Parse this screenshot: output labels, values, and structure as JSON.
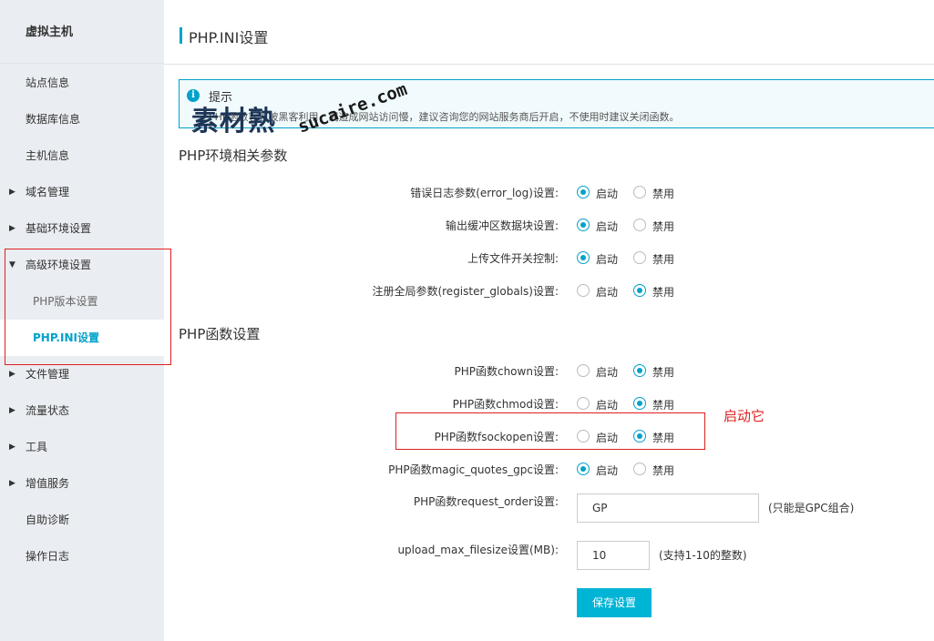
{
  "sidebar": {
    "title": "虚拟主机",
    "items": [
      {
        "label": "站点信息"
      },
      {
        "label": "数据库信息"
      },
      {
        "label": "主机信息"
      },
      {
        "label": "域名管理"
      },
      {
        "label": "基础环境设置"
      },
      {
        "label": "高级环境设置"
      },
      {
        "label": "PHP版本设置"
      },
      {
        "label": "PHP.INI设置"
      },
      {
        "label": "文件管理"
      },
      {
        "label": "流量状态"
      },
      {
        "label": "工具"
      },
      {
        "label": "增值服务"
      },
      {
        "label": "自助诊断"
      },
      {
        "label": "操作日志"
      }
    ]
  },
  "header": {
    "title": "PHP.INI设置"
  },
  "notice": {
    "title": "提示",
    "text": "PHP函数容易被黑客利用，或造成网站访问慢，建议咨询您的网站服务商后开启，不使用时建议关闭函数。"
  },
  "watermark": {
    "cn": "素材熟",
    "en": "sucaire.com"
  },
  "sections": {
    "env_title": "PHP环境相关参数",
    "func_title": "PHP函数设置"
  },
  "options": {
    "on": "启动",
    "off": "禁用"
  },
  "env_params": [
    {
      "label": "错误日志参数(error_log)设置:",
      "value": "启动"
    },
    {
      "label": "输出缓冲区数据块设置:",
      "value": "启动"
    },
    {
      "label": "上传文件开关控制:",
      "value": "启动"
    },
    {
      "label": "注册全局参数(register_globals)设置:",
      "value": "禁用"
    }
  ],
  "func_params": [
    {
      "label": "PHP函数chown设置:",
      "value": "禁用"
    },
    {
      "label": "PHP函数chmod设置:",
      "value": "禁用"
    },
    {
      "label": "PHP函数fsockopen设置:",
      "value": "禁用"
    },
    {
      "label": "PHP函数magic_quotes_gpc设置:",
      "value": "启动"
    }
  ],
  "request_order": {
    "label": "PHP函数request_order设置:",
    "value": "GP",
    "hint": "(只能是GPC组合)"
  },
  "upload_max": {
    "label": "upload_max_filesize设置(MB):",
    "value": "10",
    "hint": "(支持1-10的整数)"
  },
  "save_label": "保存设置",
  "annotation": "启动它",
  "colors": {
    "accent": "#00a2ca",
    "button": "#00b4d6",
    "annotation": "#e02020"
  }
}
